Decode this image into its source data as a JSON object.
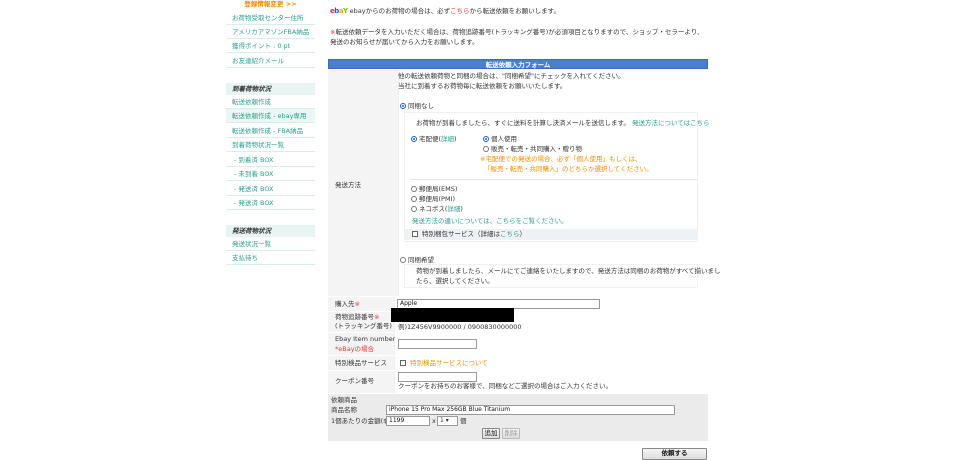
{
  "sidebar": {
    "top_link": "登録情報変更 >>",
    "items_a": [
      "お荷物受取センター住所",
      "アメリカアマゾンFBA納品",
      "獲得ポイント : 0 pt",
      "お友達紹介メール"
    ],
    "section1": "到着荷物状況",
    "items_b": [
      "転送依頼作成",
      "転送依頼作成 - ebay専用",
      "転送依頼作成 - FBA納品",
      "到着荷物状況一覧",
      "- 到着済 BOX",
      "- 未到着 BOX",
      "- 発送済 BOX",
      "- 発送済 BOX"
    ],
    "section2": "発送荷物状況",
    "items_c": [
      "発送状況一覧",
      "支払待ち"
    ]
  },
  "notice": {
    "logo_e": "e",
    "logo_b": "b",
    "logo_a": "a",
    "logo_y": "Y",
    "line1_pre": "ebayからのお荷物の場合は、必ず",
    "line1_link": "こちら",
    "line1_post": "から転送依頼をお願いします。",
    "line2_mark": "※",
    "line2": "転送依頼データを入力いただく場合は、荷物追跡番号(トラッキング番号)が必須項目となりますので、ショップ・セラーより、",
    "line3": "発送のお知らせが届いてから入力をお願いします。"
  },
  "form": {
    "title": "転送依頼入力フォーム",
    "intro1": "他の転送依頼荷物と同梱の場合は、\"同梱希望\"にチェックを入れてください。",
    "intro2": "当社に到着するお荷物毎に転送依頼をお願いいたします。",
    "method_label": "発送方法",
    "opt_nobundle": "同梱なし",
    "nobundle_note": "お荷物が到着しましたら、すぐに送料を計算し決済メールを送信します。",
    "nobundle_link": "発送方法についてはこちら",
    "takuhaibin": "宅配便(",
    "takuhaibin_link": "詳細",
    "takuhaibin_close": ")",
    "personal": "個人使用",
    "commercial": "販売・転売・共同購入・贈り物",
    "warn1": "※宅配便での発送の場合、必ず「個人使用」もしくは、",
    "warn2": "「販売・転売・共同購入」のどちらか選択してください。",
    "ems": "郵便局(EMS)",
    "pmi": "郵便局(PMI)",
    "neko": "ネコポス(",
    "neko_link": "詳細",
    "neko_close": ")",
    "diff_note": "発送方法の違いについては、こちらをご覧ください。",
    "special_pack": "特別梱包サービス（詳細は",
    "special_pack_link": "こちら",
    "special_pack_close": "）",
    "opt_bundle": "同梱希望",
    "bundle_note1": "荷物が到着しましたら、メールにてご連絡をいたしますので、発送方法は同梱のお荷物がすべて揃いまし",
    "bundle_note2": "たら、選択してください。",
    "buyer_label": "購入先",
    "required": "※",
    "buyer_value": "Apple",
    "tracking_label1": "荷物追跡番号",
    "tracking_label2": "(トラッキング番号)",
    "tracking_example": "例)1Z456V9900000 / 0900830000000",
    "ebay_label1": "Ebay Item number",
    "ebay_label2": "*eBayの場合",
    "inspect_label": "特別検品サービス",
    "inspect_link": "特別検品サービスについて",
    "coupon_label": "クーポン番号",
    "coupon_note": "クーポンをお持ちのお客様で、同梱などご選択の場合はご入力ください。",
    "goods_header": "依頼商品",
    "product_label": "商品名称",
    "product_value": "iPhone 15 Pro Max 256GB Blue Titanium",
    "price_label": "1個あたりの金額($)",
    "price_value": "1199",
    "times": "x",
    "qty_value": "1 ▾",
    "unit": "個",
    "add_btn": "追加",
    "del_btn": "削除",
    "submit_btn": "依頼する"
  }
}
